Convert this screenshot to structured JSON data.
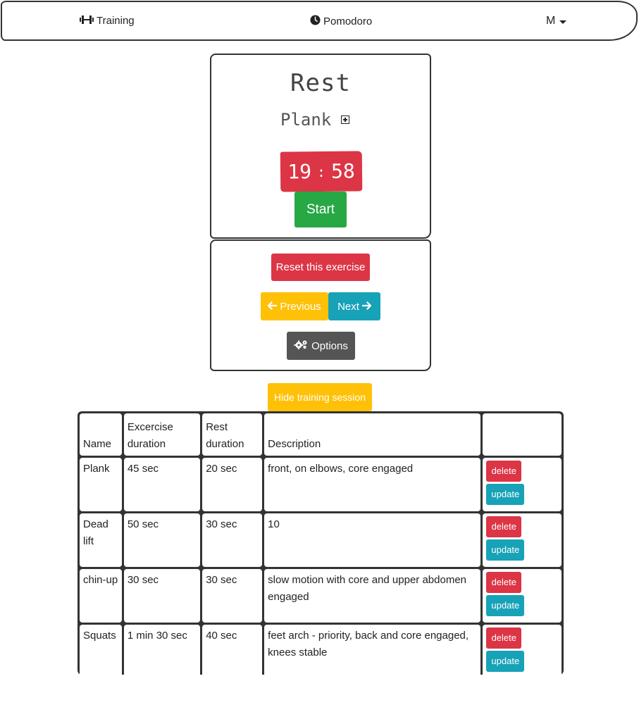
{
  "navbar": {
    "training_label": "Training",
    "training_icon": "dumbbell-icon",
    "pomodoro_label": "Pomodoro",
    "pomodoro_icon": "clock-icon",
    "user_label": "M"
  },
  "timer_card": {
    "title": "Rest",
    "exercise": "Plank",
    "minutes": "19",
    "separator": ":",
    "seconds": "58",
    "start_label": "Start"
  },
  "controls": {
    "reset_label": "Reset this exercise",
    "previous_label": "Previous",
    "next_label": "Next",
    "options_label": "Options"
  },
  "hide_session_label": "Hide training session",
  "table": {
    "headers": [
      "Name",
      "Excercise duration",
      "Rest duration",
      "Description",
      ""
    ],
    "rows": [
      {
        "name": "Plank",
        "duration": "45 sec",
        "rest": "20 sec",
        "description": "front, on elbows, core engaged"
      },
      {
        "name": "Dead lift",
        "duration": "50 sec",
        "rest": "30 sec",
        "description": "10"
      },
      {
        "name": "chin-up",
        "duration": "30 sec",
        "rest": "30 sec",
        "description": "slow motion with core and upper abdomen engaged"
      },
      {
        "name": "Squats",
        "duration": "1 min 30 sec",
        "rest": "40 sec",
        "description": "feet arch - priority, back and core engaged, knees stable"
      }
    ],
    "delete_label": "delete",
    "update_label": "update"
  },
  "colors": {
    "danger": "#dc3545",
    "success": "#28a745",
    "warning": "#ffc107",
    "info": "#17a2b8",
    "secondary": "#555555"
  }
}
